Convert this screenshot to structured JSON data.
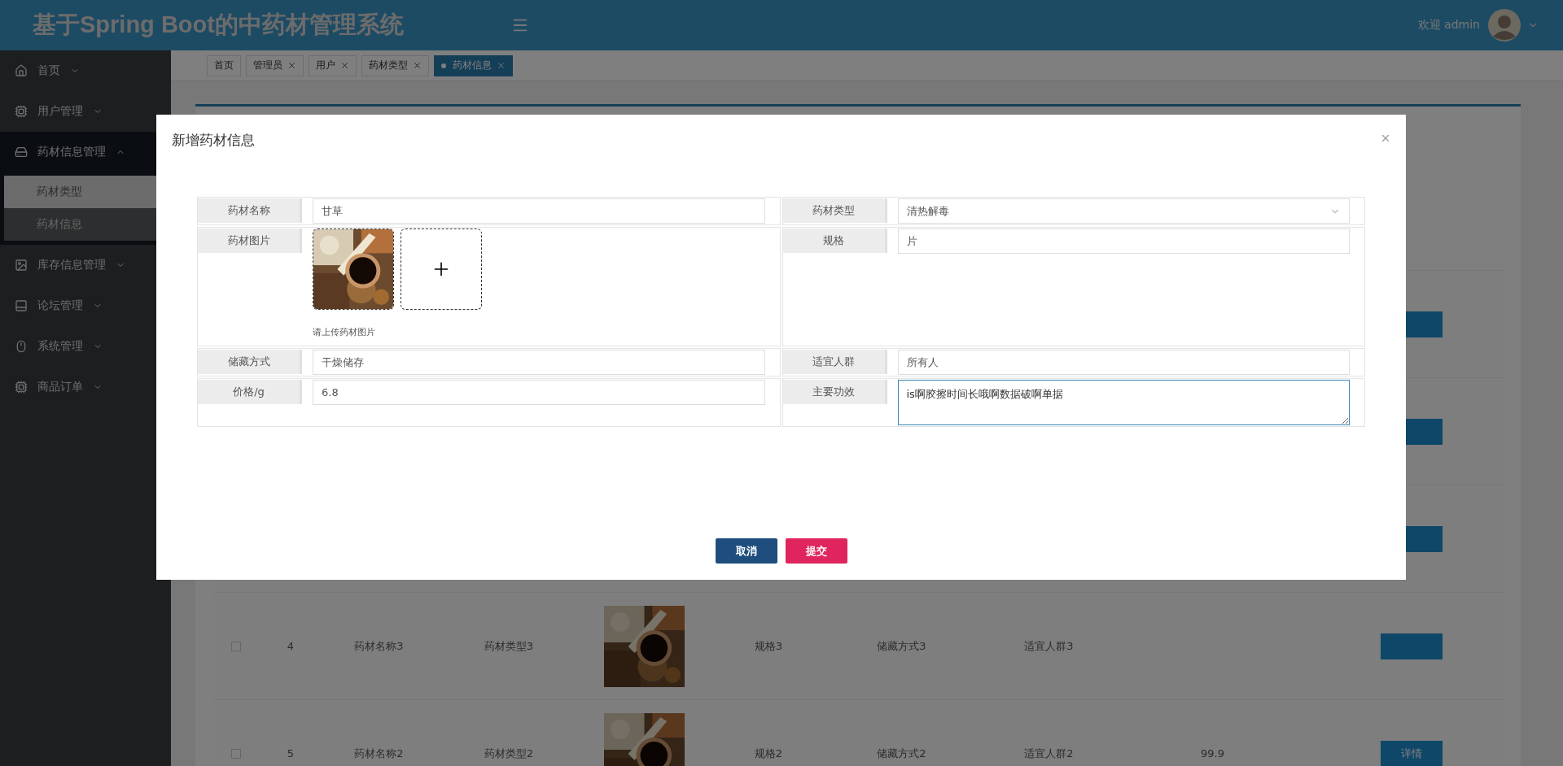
{
  "header": {
    "title": "基于Spring Boot的中药材管理系统",
    "welcome": "欢迎 admin"
  },
  "sidebar": {
    "items": [
      {
        "label": "首页",
        "expanded": false
      },
      {
        "label": "用户管理",
        "expanded": false
      },
      {
        "label": "药材信息管理",
        "expanded": true,
        "children": [
          {
            "label": "药材类型",
            "highlighted": true
          },
          {
            "label": "药材信息",
            "highlighted": false
          }
        ]
      },
      {
        "label": "库存信息管理",
        "expanded": false
      },
      {
        "label": "论坛管理",
        "expanded": false
      },
      {
        "label": "系统管理",
        "expanded": false
      },
      {
        "label": "商品订单",
        "expanded": false
      }
    ]
  },
  "tabs": [
    {
      "label": "首页",
      "selected": false,
      "closable": false
    },
    {
      "label": "管理员",
      "selected": false,
      "closable": true
    },
    {
      "label": "用户",
      "selected": false,
      "closable": true
    },
    {
      "label": "药材类型",
      "selected": false,
      "closable": true
    },
    {
      "label": "药材信息",
      "selected": true,
      "closable": true
    }
  ],
  "table": {
    "rows": [
      {
        "kind": "covered"
      },
      {
        "kind": "covered"
      },
      {
        "kind": "covered"
      },
      {
        "kind": "data",
        "index": "4",
        "name": "药材名称3",
        "type": "药材类型3",
        "spec": "规格3",
        "storage": "储藏方式3",
        "audience": "适宜人群3",
        "checked": false
      },
      {
        "kind": "data",
        "index": "5",
        "name": "药材名称2",
        "type": "药材类型2",
        "spec": "规格2",
        "storage": "储藏方式2",
        "audience": "适宜人群2",
        "price": "99.9",
        "action": "详情",
        "checked": false
      }
    ]
  },
  "dialog": {
    "title": "新增药材信息",
    "rows": [
      [
        {
          "label": "药材名称",
          "kind": "text",
          "value": "甘草"
        },
        {
          "label": "药材类型",
          "kind": "select",
          "value": "清热解毒"
        }
      ],
      [
        {
          "label": "药材图片",
          "kind": "upload",
          "hint": "请上传药材图片"
        },
        {
          "label": "规格",
          "kind": "text",
          "value": "片"
        }
      ],
      [
        {
          "label": "储藏方式",
          "kind": "text",
          "value": "干燥储存"
        },
        {
          "label": "适宜人群",
          "kind": "text",
          "value": "所有人"
        }
      ],
      [
        {
          "label": "价格/g",
          "kind": "text",
          "value": "6.8"
        },
        {
          "label": "主要功效",
          "kind": "textarea",
          "value": "is啊胶擦时间长哦啊数据破啊单据",
          "focused": true
        }
      ]
    ],
    "buttons": [
      {
        "label": "取消",
        "kind": "cancel"
      },
      {
        "label": "提交",
        "kind": "submit"
      }
    ]
  }
}
